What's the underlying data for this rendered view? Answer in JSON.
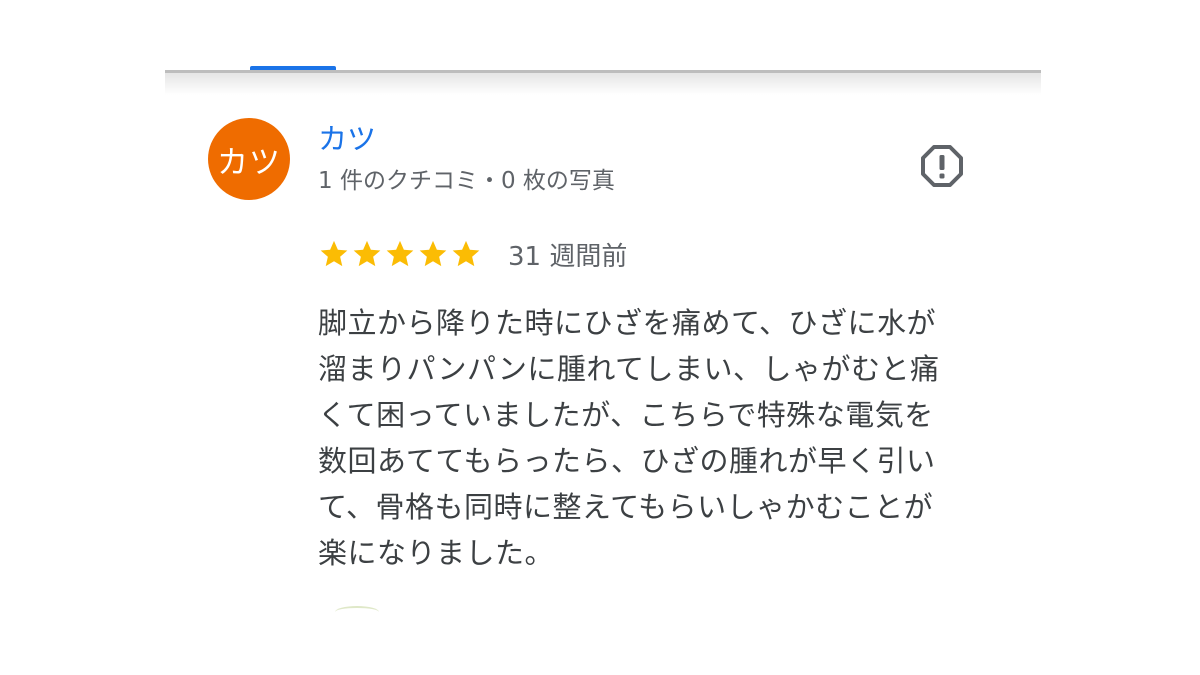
{
  "tabs": {
    "active_accent": "#1a73e8"
  },
  "review": {
    "avatar": {
      "initials": "カツ",
      "color": "#ef6c00"
    },
    "author_name": "カツ",
    "author_meta": "1 件のクチコミ・0 枚の写真",
    "report_icon": "report-flag-icon",
    "rating": 5,
    "rating_max": 5,
    "star_color": "#fbbc04",
    "time": "31 週間前",
    "text_lines": [
      "脚立から降りた時にひざを痛めて、ひざに水が",
      "溜まりパンパンに腫れてしまい、しゃがむと痛",
      "くて困っていましたが、こちらで特殊な電気を",
      "数回あててもらったら、ひざの腫れが早く引い",
      "て、骨格も同時に整えてもらいしゃかむことが",
      "楽になりました。"
    ]
  }
}
